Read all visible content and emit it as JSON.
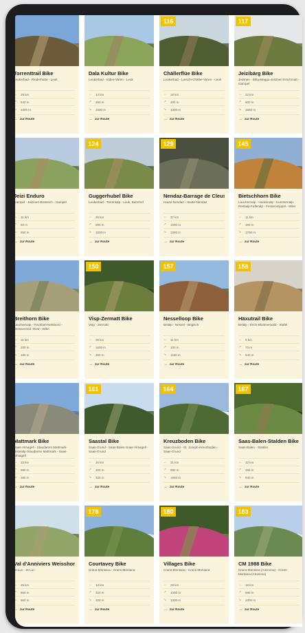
{
  "cards": [
    {
      "badge": "",
      "title": "Torrenttrail Bike",
      "route": "Leukerbad - Rinderhütte - Leuk",
      "stats": [
        "29 km",
        "540 m",
        "2300 m"
      ],
      "link": "zur Route",
      "colors": [
        "#7aa6d8",
        "#8a7a52",
        "#6c5c3b",
        "#b39c74"
      ]
    },
    {
      "badge": "",
      "title": "Dala Kultur Bike",
      "route": "Leukerbad - Inden-Varen - Leuk",
      "stats": [
        "14 km",
        "260 m",
        "1500 m"
      ],
      "link": "zur Route",
      "colors": [
        "#a9c8e6",
        "#5b7a3b",
        "#8aa45a",
        "#9b8660"
      ]
    },
    {
      "badge": "116",
      "title": "Chällerflüe Bike",
      "route": "Leukerbad - Larschi-Chäller-Varen - Leuk",
      "stats": [
        "18 km",
        "300 m",
        "1300 m"
      ],
      "link": "zur Route",
      "colors": [
        "#c9d6de",
        "#6f6a52",
        "#4f5d33",
        "#8d7b5a"
      ]
    },
    {
      "badge": "117",
      "title": "Jeizibärg Bike",
      "route": "Jeizinen - Bifig-Meggu-Jeizinen Erschmatt - Gampel",
      "stats": [
        "22 km",
        "600 m",
        "1850 m"
      ],
      "link": "zur Route",
      "colors": [
        "#e6e8ea",
        "#7b8c4a",
        "#6c7a3f",
        "#9c8a5e"
      ]
    },
    {
      "badge": "",
      "title": "Jeizi Enduro",
      "route": "Gampel - Jeizinen-Brantsch - Gampel",
      "stats": [
        "11 km",
        "60 m",
        "950 m"
      ],
      "link": "zur Route",
      "colors": [
        "#b8cbe0",
        "#5d7a3f",
        "#8aa160",
        "#a88e62"
      ]
    },
    {
      "badge": "124",
      "title": "Guggerhubel Bike",
      "route": "Leukerbad - Torrentalp - Leuk, Bahnhof",
      "stats": [
        "26 km",
        "590 m",
        "1500 m"
      ],
      "link": "zur Route",
      "colors": [
        "#bfcdd8",
        "#5c6e3a",
        "#7a8a48",
        "#a58e66"
      ]
    },
    {
      "badge": "129",
      "title": "Nendaz-Barrage de Cleuson Bike",
      "route": "Haute-Nendaz - Haute-Nendaz",
      "stats": [
        "37 km",
        "1000 m",
        "1300 m"
      ],
      "link": "zur Route",
      "colors": [
        "#4a4f3f",
        "#3b4230",
        "#6b6e58",
        "#8f8d74"
      ]
    },
    {
      "badge": "145",
      "title": "Bietschhorn Bike",
      "route": "Lauchernalp - Hockenalp - Kummenalp-Restialp-Fafleralp - Ferden-Kippel - Wiler",
      "stats": [
        "11 km",
        "480 m",
        "1700 m"
      ],
      "link": "zur Route",
      "colors": [
        "#8fb0d4",
        "#9a6e3c",
        "#c1823b",
        "#5f6d3a"
      ]
    },
    {
      "badge": "",
      "title": "Breithorn Bike",
      "route": "Lauchernalp - Fischbiel-Nektbord - Weissenried -Ried - Wiler",
      "stats": [
        "11 km",
        "200 m",
        "180 m"
      ],
      "link": "zur Route",
      "colors": [
        "#7fa8d6",
        "#7b8a56",
        "#a5a07a",
        "#6f7a55"
      ]
    },
    {
      "badge": "150",
      "title": "Visp-Zermatt Bike",
      "route": "Visp - Zermatt",
      "stats": [
        "38 km",
        "1600 m",
        "460 m"
      ],
      "link": "zur Route",
      "colors": [
        "#3e5a2a",
        "#2f4720",
        "#6b7e3c",
        "#a49a6a"
      ]
    },
    {
      "badge": "157",
      "title": "Nesselloop Bike",
      "route": "Belalp - Nessel - Brigisch",
      "stats": [
        "11 km",
        "100 m",
        "1150 m"
      ],
      "link": "zur Route",
      "colors": [
        "#93b9de",
        "#6a7a40",
        "#8d5f3a",
        "#b59770"
      ]
    },
    {
      "badge": "158",
      "title": "Häxutrail Bike",
      "route": "Belalp - Erich-Bluttmerwald - Stafel",
      "stats": [
        "6 km",
        "70 m",
        "640 m"
      ],
      "link": "zur Route",
      "colors": [
        "#d7d3c8",
        "#9b7a4f",
        "#b59464",
        "#7c6a45"
      ]
    },
    {
      "badge": "",
      "title": "Mattmark Bike",
      "route": "Saas-Almagell - Staudamm Mattmark-Distelalp-Staudamm Mattmark - Saas-Almagell",
      "stats": [
        "22 km",
        "580 m",
        "380 m"
      ],
      "link": "zur Route",
      "colors": [
        "#7fa9d8",
        "#5c7da0",
        "#8a8a7a",
        "#b2a88e"
      ]
    },
    {
      "badge": "161",
      "title": "Saastal Bike",
      "route": "Saas-Grund - Saas-Balen-Saas-Almagell - Saas-Grund",
      "stats": [
        "16 km",
        "320 m",
        "320 m"
      ],
      "link": "zur Route",
      "colors": [
        "#c9dced",
        "#5d7b3c",
        "#3f5a2c",
        "#8e9b6a"
      ]
    },
    {
      "badge": "164",
      "title": "Kreuzboden Bike",
      "route": "Saas-Grund - St. Joseph-Kreuzboden - Saas-Grund",
      "stats": [
        "31 km",
        "950 m",
        "1950 m"
      ],
      "link": "zur Route",
      "colors": [
        "#9bb9dc",
        "#e6eaef",
        "#4d6a33",
        "#7a8a55"
      ]
    },
    {
      "badge": "167",
      "title": "Saas-Balen-Stalden Bike",
      "route": "Saas-Balen - Stalden",
      "stats": [
        "12 km",
        "155 m",
        "840 m"
      ],
      "link": "zur Route",
      "colors": [
        "#4c6a2e",
        "#2e4420",
        "#6d8a45",
        "#8f7a52"
      ]
    },
    {
      "badge": "",
      "title": "Val d'Anniviers Weisshorn Bike",
      "route": "St-Luc - St-Luc",
      "stats": [
        "25 km",
        "860 m",
        "860 m"
      ],
      "link": "zur Route",
      "colors": [
        "#cfe0ea",
        "#6f8a4a",
        "#93a66a",
        "#a89c76"
      ]
    },
    {
      "badge": "178",
      "title": "Courtavey Bike",
      "route": "Crans-Montana - Crans-Montana",
      "stats": [
        "13 km",
        "320 m",
        "320 m"
      ],
      "link": "zur Route",
      "colors": [
        "#8fb4dc",
        "#dfe6ee",
        "#5f7d3b",
        "#7c9450"
      ]
    },
    {
      "badge": "180",
      "title": "Villages Bike",
      "route": "Crans-Montana - Crans-Montana",
      "stats": [
        "28 km",
        "1000 m",
        "1000 m"
      ],
      "link": "zur Route",
      "colors": [
        "#3e5a2a",
        "#5d7c3a",
        "#c0437a",
        "#7a9a4a"
      ]
    },
    {
      "badge": "183",
      "title": "CM 1988 Bike",
      "route": "Crans-Montana (Aminona) - Crans-Montana (Aminona)",
      "stats": [
        "18 km",
        "680 m",
        "1000 m"
      ],
      "link": "zur Route",
      "colors": [
        "#b7cfe8",
        "#e6edf3",
        "#6b8a52",
        "#97a776"
      ]
    }
  ]
}
